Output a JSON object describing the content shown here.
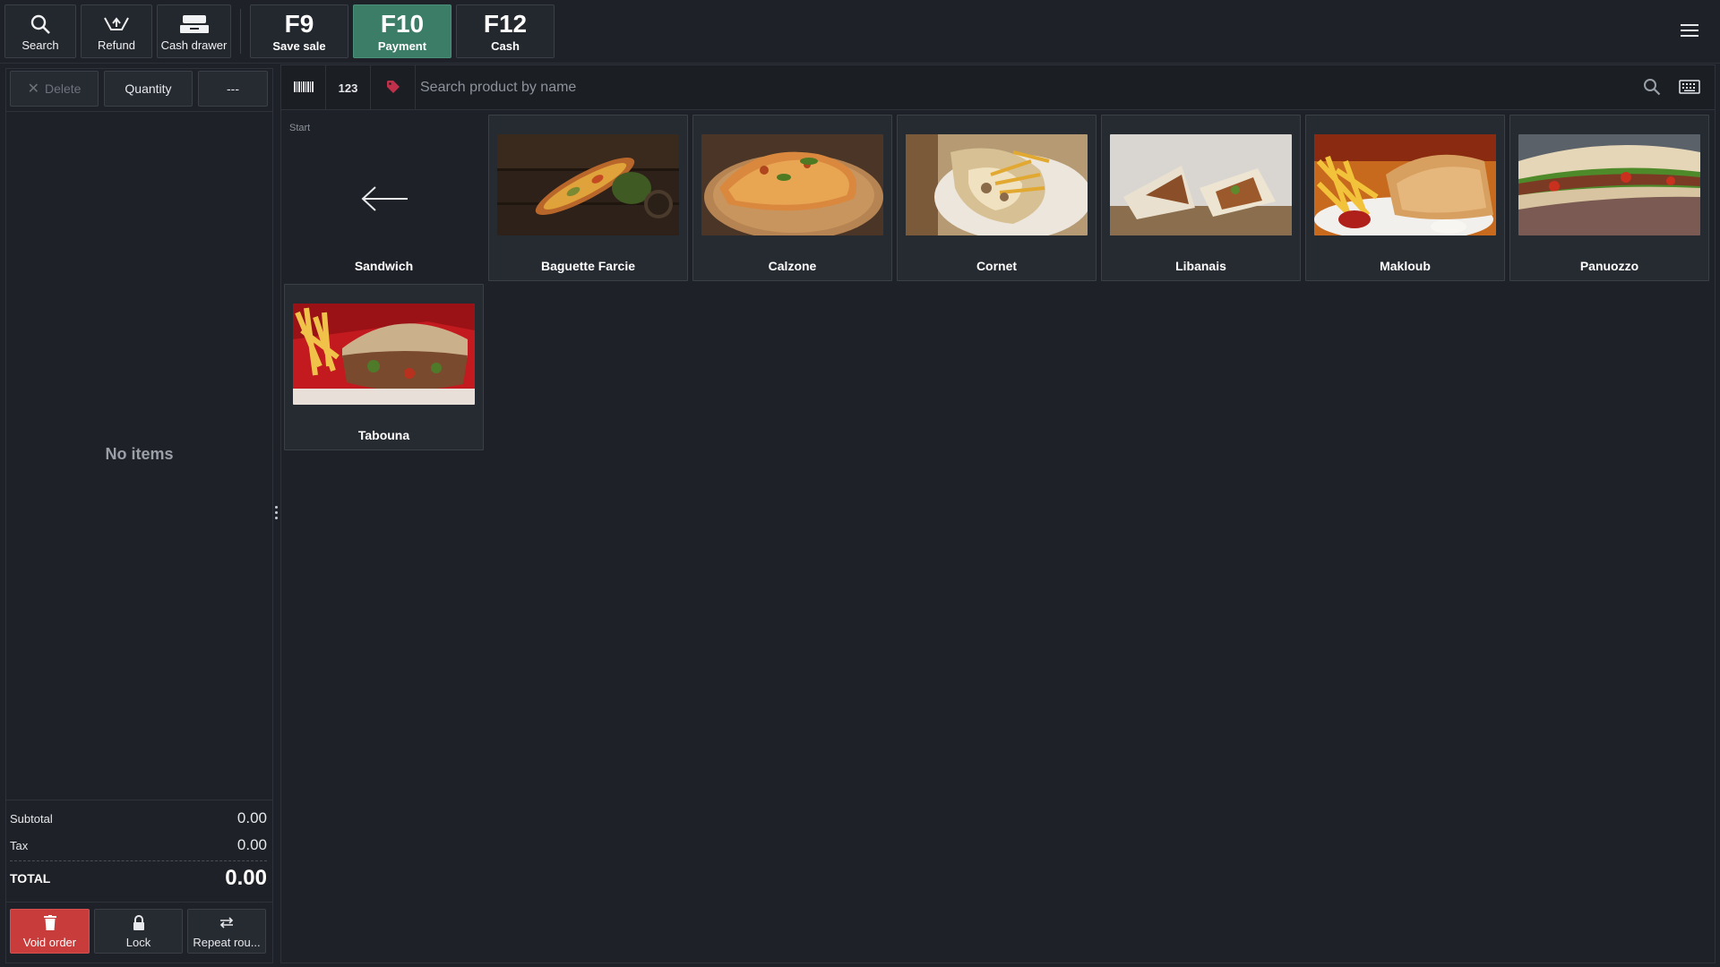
{
  "toolbar": {
    "search_label": "Search",
    "refund_label": "Refund",
    "cash_drawer_label": "Cash drawer",
    "fn_buttons": [
      {
        "key": "F9",
        "label": "Save sale"
      },
      {
        "key": "F10",
        "label": "Payment"
      },
      {
        "key": "F12",
        "label": "Cash"
      }
    ],
    "active_color": "#3b7d66"
  },
  "order_panel": {
    "delete_label": "Delete",
    "quantity_label": "Quantity",
    "more_label": "---",
    "empty_text": "No items",
    "subtotal_label": "Subtotal",
    "subtotal_value": "0.00",
    "tax_label": "Tax",
    "tax_value": "0.00",
    "total_label": "TOTAL",
    "total_value": "0.00",
    "void_label": "Void order",
    "lock_label": "Lock",
    "repeat_label": "Repeat rou...",
    "void_color": "#c93c3c"
  },
  "search": {
    "barcode_icon": "barcode-icon",
    "numeric_label": "123",
    "tag_icon": "tag-icon",
    "placeholder": "Search product by name",
    "tag_color": "#c0304a"
  },
  "catalog": {
    "breadcrumb": "Start",
    "category": "Sandwich",
    "products": [
      {
        "name": "Baguette Farcie"
      },
      {
        "name": "Calzone"
      },
      {
        "name": "Cornet"
      },
      {
        "name": "Libanais"
      },
      {
        "name": "Makloub"
      },
      {
        "name": "Panuozzo"
      },
      {
        "name": "Tabouna"
      }
    ]
  }
}
